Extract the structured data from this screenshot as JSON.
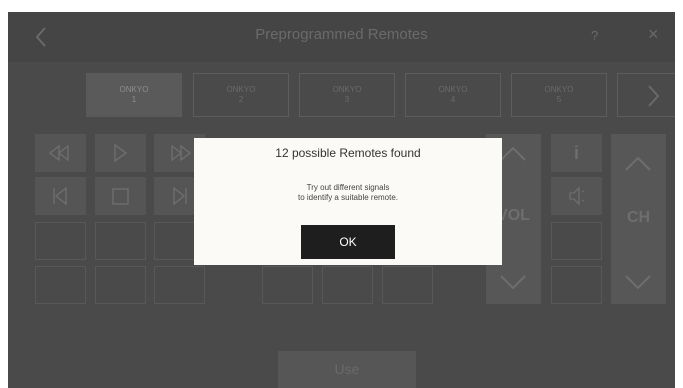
{
  "header": {
    "title": "Preprogrammed Remotes",
    "back_icon": "chevron-left-icon",
    "help_label": "?",
    "close_label": "×"
  },
  "remote_tiles": [
    {
      "brand": "ONKYO",
      "number": "1",
      "selected": true
    },
    {
      "brand": "ONKYO",
      "number": "2",
      "selected": false
    },
    {
      "brand": "ONKYO",
      "number": "3",
      "selected": false
    },
    {
      "brand": "ONKYO",
      "number": "4",
      "selected": false
    },
    {
      "brand": "ONKYO",
      "number": "5",
      "selected": false
    }
  ],
  "next_icon": "chevron-right-icon",
  "controls": {
    "rewind_icon": "rewind-icon",
    "play_icon": "play-icon",
    "fast_forward_icon": "fast-forward-icon",
    "skip_back_icon": "skip-back-icon",
    "stop_icon": "stop-icon",
    "skip_forward_icon": "skip-forward-icon",
    "info_label": "i",
    "mute_icon": "speaker-icon",
    "vol_label": "VOL",
    "ch_label": "CH"
  },
  "use_button": {
    "label": "Use"
  },
  "dialog": {
    "title": "12 possible Remotes found",
    "message_line1": "Try out different signals",
    "message_line2": "to identify a suitable remote.",
    "ok_label": "OK"
  },
  "colors": {
    "overlay": "#4a4a4a",
    "dialog_bg": "#fbfaf6",
    "ok_button": "#1e1e1e"
  }
}
